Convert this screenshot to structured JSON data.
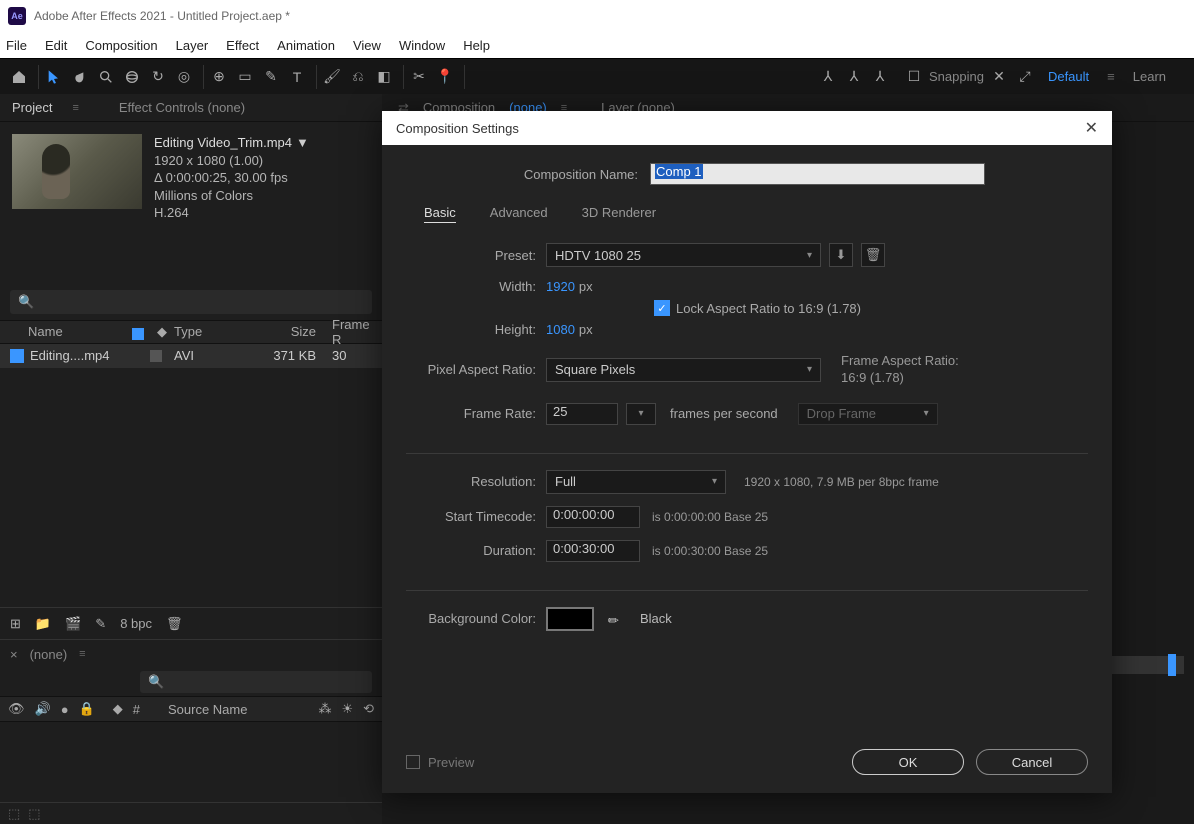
{
  "window": {
    "title": "Adobe After Effects 2021 - Untitled Project.aep *"
  },
  "menu": [
    "File",
    "Edit",
    "Composition",
    "Layer",
    "Effect",
    "Animation",
    "View",
    "Window",
    "Help"
  ],
  "toolbar_right": {
    "snapping": "Snapping",
    "default": "Default",
    "learn": "Learn"
  },
  "project_panel": {
    "tabs": {
      "project": "Project",
      "effect_controls": "Effect Controls (none)"
    },
    "asset": {
      "name": "Editing Video_Trim.mp4",
      "dims": "1920 x 1080 (1.00)",
      "dur": "Δ 0:00:00:25, 30.00 fps",
      "colors": "Millions of Colors",
      "codec": "H.264"
    },
    "cols": {
      "name": "Name",
      "type": "Type",
      "size": "Size",
      "frame": "Frame R"
    },
    "row": {
      "name": "Editing....mp4",
      "type": "AVI",
      "size": "371 KB",
      "frame": "30"
    },
    "bpc": "8 bpc"
  },
  "timeline": {
    "none": "(none)",
    "source": "Source Name",
    "num": "#"
  },
  "center": {
    "comp_label": "Composition",
    "none": "(none)",
    "layer": "Layer (none)"
  },
  "dialog": {
    "title": "Composition Settings",
    "name_label": "Composition Name:",
    "name_value": "Comp 1",
    "tabs": {
      "basic": "Basic",
      "advanced": "Advanced",
      "renderer": "3D Renderer"
    },
    "preset_label": "Preset:",
    "preset_value": "HDTV 1080 25",
    "width_label": "Width:",
    "width_value": "1920",
    "height_label": "Height:",
    "height_value": "1080",
    "px": "px",
    "lock": "Lock Aspect Ratio to 16:9 (1.78)",
    "par_label": "Pixel Aspect Ratio:",
    "par_value": "Square Pixels",
    "far_label": "Frame Aspect Ratio:",
    "far_value": "16:9 (1.78)",
    "fr_label": "Frame Rate:",
    "fr_value": "25",
    "fps": "frames per second",
    "drop": "Drop Frame",
    "res_label": "Resolution:",
    "res_value": "Full",
    "res_note": "1920 x 1080, 7.9 MB per 8bpc frame",
    "start_label": "Start Timecode:",
    "start_value": "0:00:00:00",
    "start_note": "is 0:00:00:00  Base 25",
    "dur_label": "Duration:",
    "dur_value": "0:00:30:00",
    "dur_note": "is 0:00:30:00  Base 25",
    "bg_label": "Background Color:",
    "bg_name": "Black",
    "preview": "Preview",
    "ok": "OK",
    "cancel": "Cancel"
  }
}
